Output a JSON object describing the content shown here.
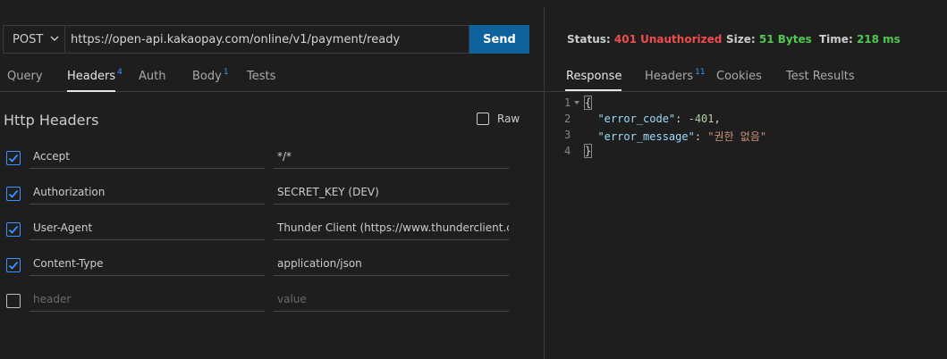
{
  "request": {
    "method": "POST",
    "url": "https://open-api.kakaopay.com/online/v1/payment/ready",
    "send_label": "Send"
  },
  "request_tabs": [
    {
      "label": "Query",
      "badge": ""
    },
    {
      "label": "Headers",
      "badge": "4"
    },
    {
      "label": "Auth",
      "badge": ""
    },
    {
      "label": "Body",
      "badge": "1"
    },
    {
      "label": "Tests",
      "badge": ""
    }
  ],
  "headers_panel": {
    "title": "Http Headers",
    "raw_label": "Raw",
    "rows": [
      {
        "checked": true,
        "key": "Accept",
        "value": "*/*"
      },
      {
        "checked": true,
        "key": "Authorization",
        "value": "SECRET_KEY (DEV)"
      },
      {
        "checked": true,
        "key": "User-Agent",
        "value": "Thunder Client (https://www.thunderclient.com)"
      },
      {
        "checked": true,
        "key": "Content-Type",
        "value": "application/json"
      }
    ],
    "new_row": {
      "key_placeholder": "header",
      "value_placeholder": "value"
    }
  },
  "response_status": {
    "status_label": "Status:",
    "status_value": "401 Unauthorized",
    "size_label": "Size:",
    "size_value": "51 Bytes",
    "time_label": "Time:",
    "time_value": "218 ms",
    "colors": {
      "error": "#f14c4c",
      "ok": "#4ec94e"
    }
  },
  "response_tabs": [
    {
      "label": "Response",
      "badge": ""
    },
    {
      "label": "Headers",
      "badge": "11"
    },
    {
      "label": "Cookies",
      "badge": ""
    },
    {
      "label": "Test Results",
      "badge": ""
    }
  ],
  "response_body": {
    "line_numbers": [
      "1",
      "2",
      "3",
      "4"
    ],
    "open_brace": "{",
    "close_brace": "}",
    "error_code_key": "\"error_code\"",
    "error_code_value": "-401",
    "error_message_key": "\"error_message\"",
    "error_message_value": "\"권한 없음\""
  }
}
